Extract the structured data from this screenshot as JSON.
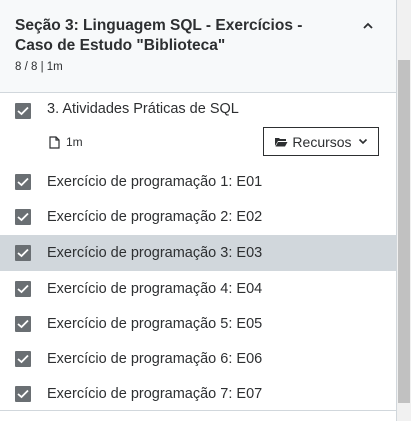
{
  "section": {
    "title": "Seção 3: Linguagem SQL - Exercícios - Caso de Estudo \"Biblioteca\"",
    "meta": "8 / 8 | 1m",
    "collapse_icon": "chevron-up-icon"
  },
  "lectures": [
    {
      "label": "3. Atividades Práticas de SQL",
      "completed": true,
      "duration": "1m",
      "resources_label": "Recursos"
    },
    {
      "label": "Exercício de programação 1: E01",
      "completed": true
    },
    {
      "label": "Exercício de programação 2: E02",
      "completed": true
    },
    {
      "label": "Exercício de programação 3: E03",
      "completed": true,
      "active": true
    },
    {
      "label": "Exercício de programação 4: E04",
      "completed": true
    },
    {
      "label": "Exercício de programação 5: E05",
      "completed": true
    },
    {
      "label": "Exercício de programação 6: E06",
      "completed": true
    },
    {
      "label": "Exercício de programação 7: E07",
      "completed": true
    }
  ],
  "colors": {
    "checkbox": "#6a6f73",
    "active_row": "#d1d7dc",
    "header_bg": "#f7f9fa",
    "text": "#2d2f31"
  }
}
